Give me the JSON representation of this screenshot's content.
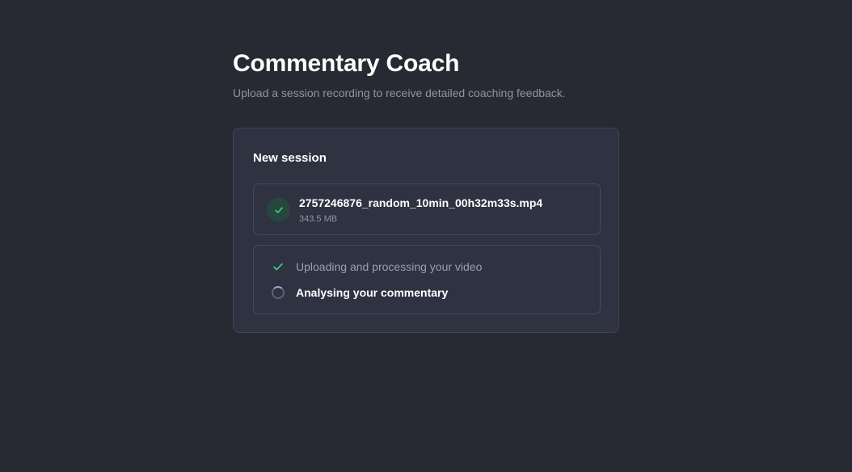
{
  "header": {
    "title": "Commentary Coach",
    "subtitle": "Upload a session recording to receive detailed coaching feedback."
  },
  "card": {
    "title": "New session",
    "file": {
      "name": "2757246876_random_10min_00h32m33s.mp4",
      "size": "343.5 MB",
      "status_icon": "check-icon"
    },
    "steps": [
      {
        "label": "Uploading and processing your video",
        "status": "done",
        "icon": "check-icon"
      },
      {
        "label": "Analysing your commentary",
        "status": "in-progress",
        "icon": "spinner-icon"
      }
    ]
  },
  "colors": {
    "background": "#282a33",
    "card": "#2f3341",
    "success": "#3fcf7f",
    "text_muted": "#8e94a3"
  }
}
